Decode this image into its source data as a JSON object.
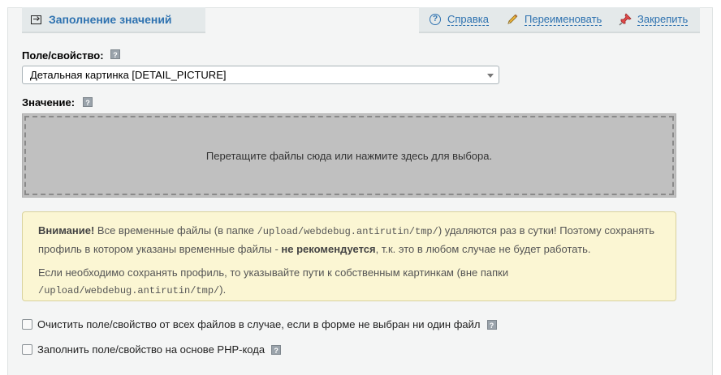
{
  "panel": {
    "title": "Заполнение значений",
    "actions": {
      "help": "Справка",
      "rename": "Переименовать",
      "pin": "Закрепить"
    }
  },
  "field": {
    "label": "Поле/свойство:",
    "selected": "Детальная картинка [DETAIL_PICTURE]"
  },
  "value": {
    "label": "Значение:",
    "dropzone_text": "Перетащите файлы сюда или нажмите здесь для выбора."
  },
  "hint_glyph": "?",
  "note": {
    "p1_bold": "Внимание!",
    "p1_a": " Все временные файлы (в папке ",
    "p1_path": "/upload/webdebug.antirutin/tmp/",
    "p1_b": ") удаляются раз в сутки! Поэтому сохранять профиль в котором указаны временные файлы - ",
    "p1_bold2": "не рекомендуется",
    "p1_c": ", т.к. это в любом случае не будет работать.",
    "p2_a": "Если необходимо сохранять профиль, то указывайте пути к собственным картинкам (вне папки ",
    "p2_path": "/upload/webdebug.antirutin/tmp/",
    "p2_b": ")."
  },
  "options": {
    "clear_label": "Очистить поле/свойство от всех файлов в случае, если в форме не выбран ни один файл",
    "php_label": "Заполнить поле/свойство на основе PHP-кода"
  },
  "colors": {
    "accent": "#2e72b0",
    "panel_bg": "#f4f5f5",
    "tab_bg": "#e4e9ea",
    "note_bg": "#fbf6d3",
    "dropzone_bg": "#c0c0c0"
  },
  "icons": [
    "enter-icon",
    "help-icon",
    "pencil-icon",
    "pin-icon",
    "hint-icon"
  ]
}
